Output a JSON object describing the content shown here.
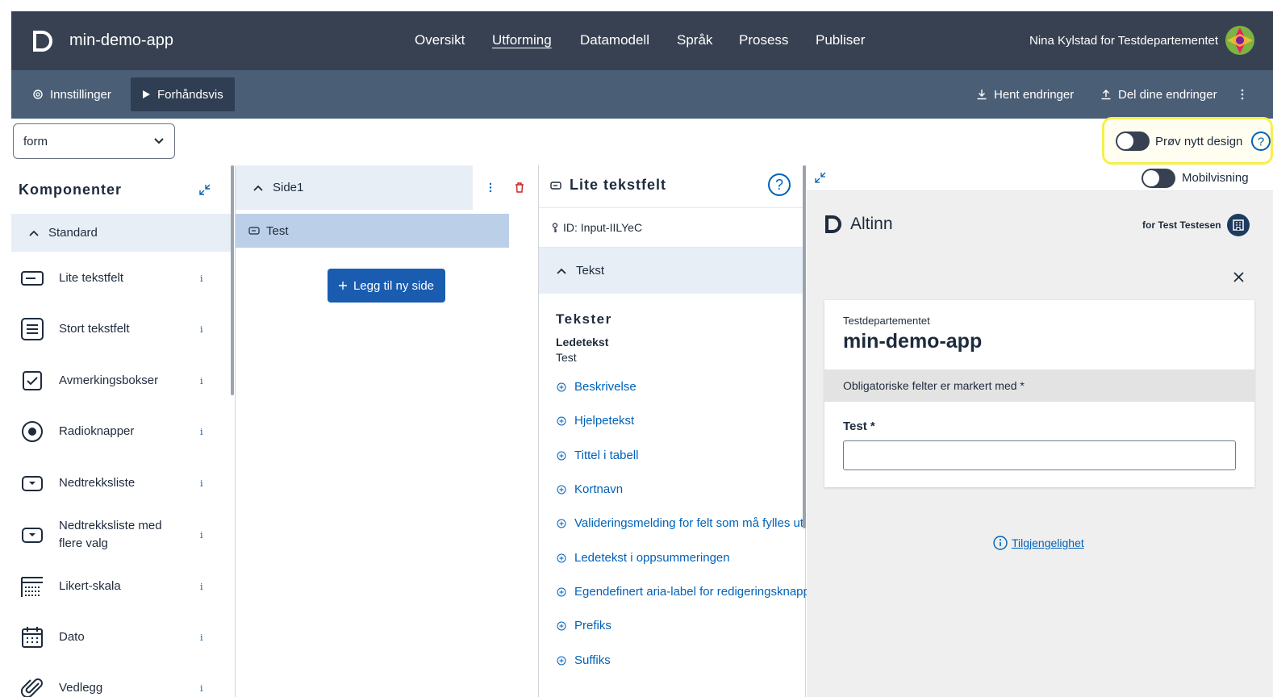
{
  "topbar": {
    "app_name": "min-demo-app",
    "nav": [
      "Oversikt",
      "Utforming",
      "Datamodell",
      "Språk",
      "Prosess",
      "Publiser"
    ],
    "active_nav": "Utforming",
    "user": "Nina Kylstad for Testdepartementet"
  },
  "subbar": {
    "settings": "Innstillinger",
    "preview": "Forhåndsvis",
    "fetch": "Hent endringer",
    "share": "Del dine endringer"
  },
  "toolbar": {
    "layout_set": "form",
    "try_design": "Prøv nytt design"
  },
  "components": {
    "title": "Komponenter",
    "group": "Standard",
    "items": [
      {
        "label": "Lite tekstfelt",
        "icon": "short-text-icon"
      },
      {
        "label": "Stort tekstfelt",
        "icon": "long-text-icon"
      },
      {
        "label": "Avmerkingsbokser",
        "icon": "checkbox-icon"
      },
      {
        "label": "Radioknapper",
        "icon": "radio-icon"
      },
      {
        "label": "Nedtrekksliste",
        "icon": "dropdown-icon"
      },
      {
        "label": "Nedtrekksliste med flere valg",
        "icon": "multi-dropdown-icon"
      },
      {
        "label": "Likert-skala",
        "icon": "likert-icon"
      },
      {
        "label": "Dato",
        "icon": "calendar-icon"
      },
      {
        "label": "Vedlegg",
        "icon": "paperclip-icon"
      }
    ],
    "info_glyph": "i"
  },
  "pages": {
    "page_name": "Side1",
    "component": "Test",
    "add_page": "Legg til ny side"
  },
  "properties": {
    "title": "Lite tekstfelt",
    "id": "ID: Input-IILYeC",
    "section": "Tekst",
    "texts_heading": "Tekster",
    "label_title": "Ledetekst",
    "label_value": "Test",
    "links": [
      "Beskrivelse",
      "Hjelpetekst",
      "Tittel i tabell",
      "Kortnavn",
      "Valideringsmelding for felt som må fylles ut",
      "Ledetekst i oppsummeringen",
      "Egendefinert aria-label for redigeringsknapp",
      "Prefiks",
      "Suffiks"
    ]
  },
  "preview": {
    "mobile_label": "Mobilvisning",
    "brand": "Altinn",
    "party": "for Test Testesen",
    "org": "Testdepartementet",
    "app_title": "min-demo-app",
    "required_note": "Obligatoriske felter er markert med *",
    "field_label": "Test *",
    "accessibility": "Tilgjengelighet"
  },
  "colors": {
    "topbar": "#374151",
    "subbar": "#4a5e76",
    "accent": "#1a5db0",
    "link": "#0062ba",
    "highlight": "#f7ef4c"
  }
}
